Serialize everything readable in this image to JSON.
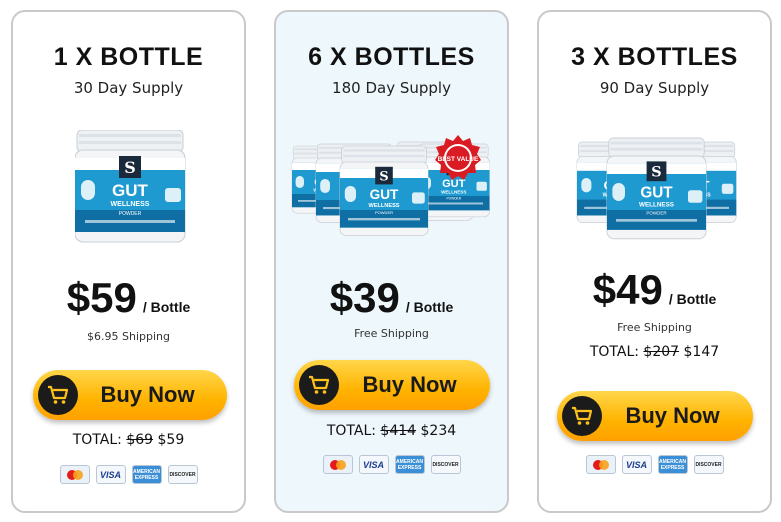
{
  "offers": [
    {
      "title": "1 X BOTTLE",
      "supply": "30 Day Supply",
      "price": "$59",
      "per": "/ Bottle",
      "shipping": "$6.95 Shipping",
      "buy_label": "Buy Now",
      "total_prefix": "TOTAL: ",
      "old_total": "$69",
      "new_total": "$59"
    },
    {
      "title": "6 X BOTTLES",
      "supply": "180 Day Supply",
      "price": "$39",
      "per": "/ Bottle",
      "shipping": "Free Shipping",
      "badge": "BEST VALUE",
      "buy_label": "Buy Now",
      "total_prefix": "TOTAL: ",
      "old_total": "$414",
      "new_total": "$234"
    },
    {
      "title": "3 X BOTTLES",
      "supply": "90 Day Supply",
      "price": "$49",
      "per": "/ Bottle",
      "shipping": "Free Shipping",
      "buy_label": "Buy Now",
      "total_prefix": "TOTAL: ",
      "old_total": "$207",
      "new_total": "$147"
    }
  ],
  "product_label": {
    "brand_letter": "S",
    "name": "GUT",
    "line": "WELLNESS",
    "form": "POWDER"
  },
  "payments": {
    "mastercard": "",
    "visa": "VISA",
    "amex": "AMERICAN EXPRESS",
    "discover": "DISCOVER"
  },
  "colors": {
    "button": "#ffb300",
    "card_border": "#c9c9c9",
    "featured_bg": "#eef7fc",
    "jar_blue": "#1c8fc4",
    "badge_red": "#d91c24"
  }
}
